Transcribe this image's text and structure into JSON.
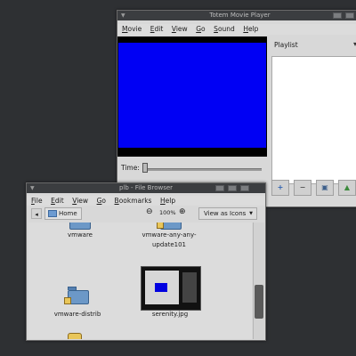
{
  "totem": {
    "title": "Totem Movie Player",
    "menu": [
      "Movie",
      "Edit",
      "View",
      "Go",
      "Sound",
      "Help"
    ],
    "playlist_label": "Playlist",
    "time_label": "Time:",
    "playlist_buttons": [
      {
        "name": "add",
        "glyph": "+"
      },
      {
        "name": "remove",
        "glyph": "−"
      },
      {
        "name": "save",
        "glyph": "▣"
      },
      {
        "name": "move-up",
        "glyph": "▲"
      }
    ],
    "colors": {
      "video_bg": "#0000f4"
    }
  },
  "files": {
    "title": "plb - File Browser",
    "menu": [
      "File",
      "Edit",
      "View",
      "Go",
      "Bookmarks",
      "Help"
    ],
    "home_label": "Home",
    "zoom_level": "100%",
    "view_mode": "View as Icons",
    "items": [
      {
        "label": "vmware"
      },
      {
        "label": "vmware-any-any-update101"
      },
      {
        "label": "vmware-distrib"
      },
      {
        "label": "serenity.jpg"
      }
    ]
  }
}
